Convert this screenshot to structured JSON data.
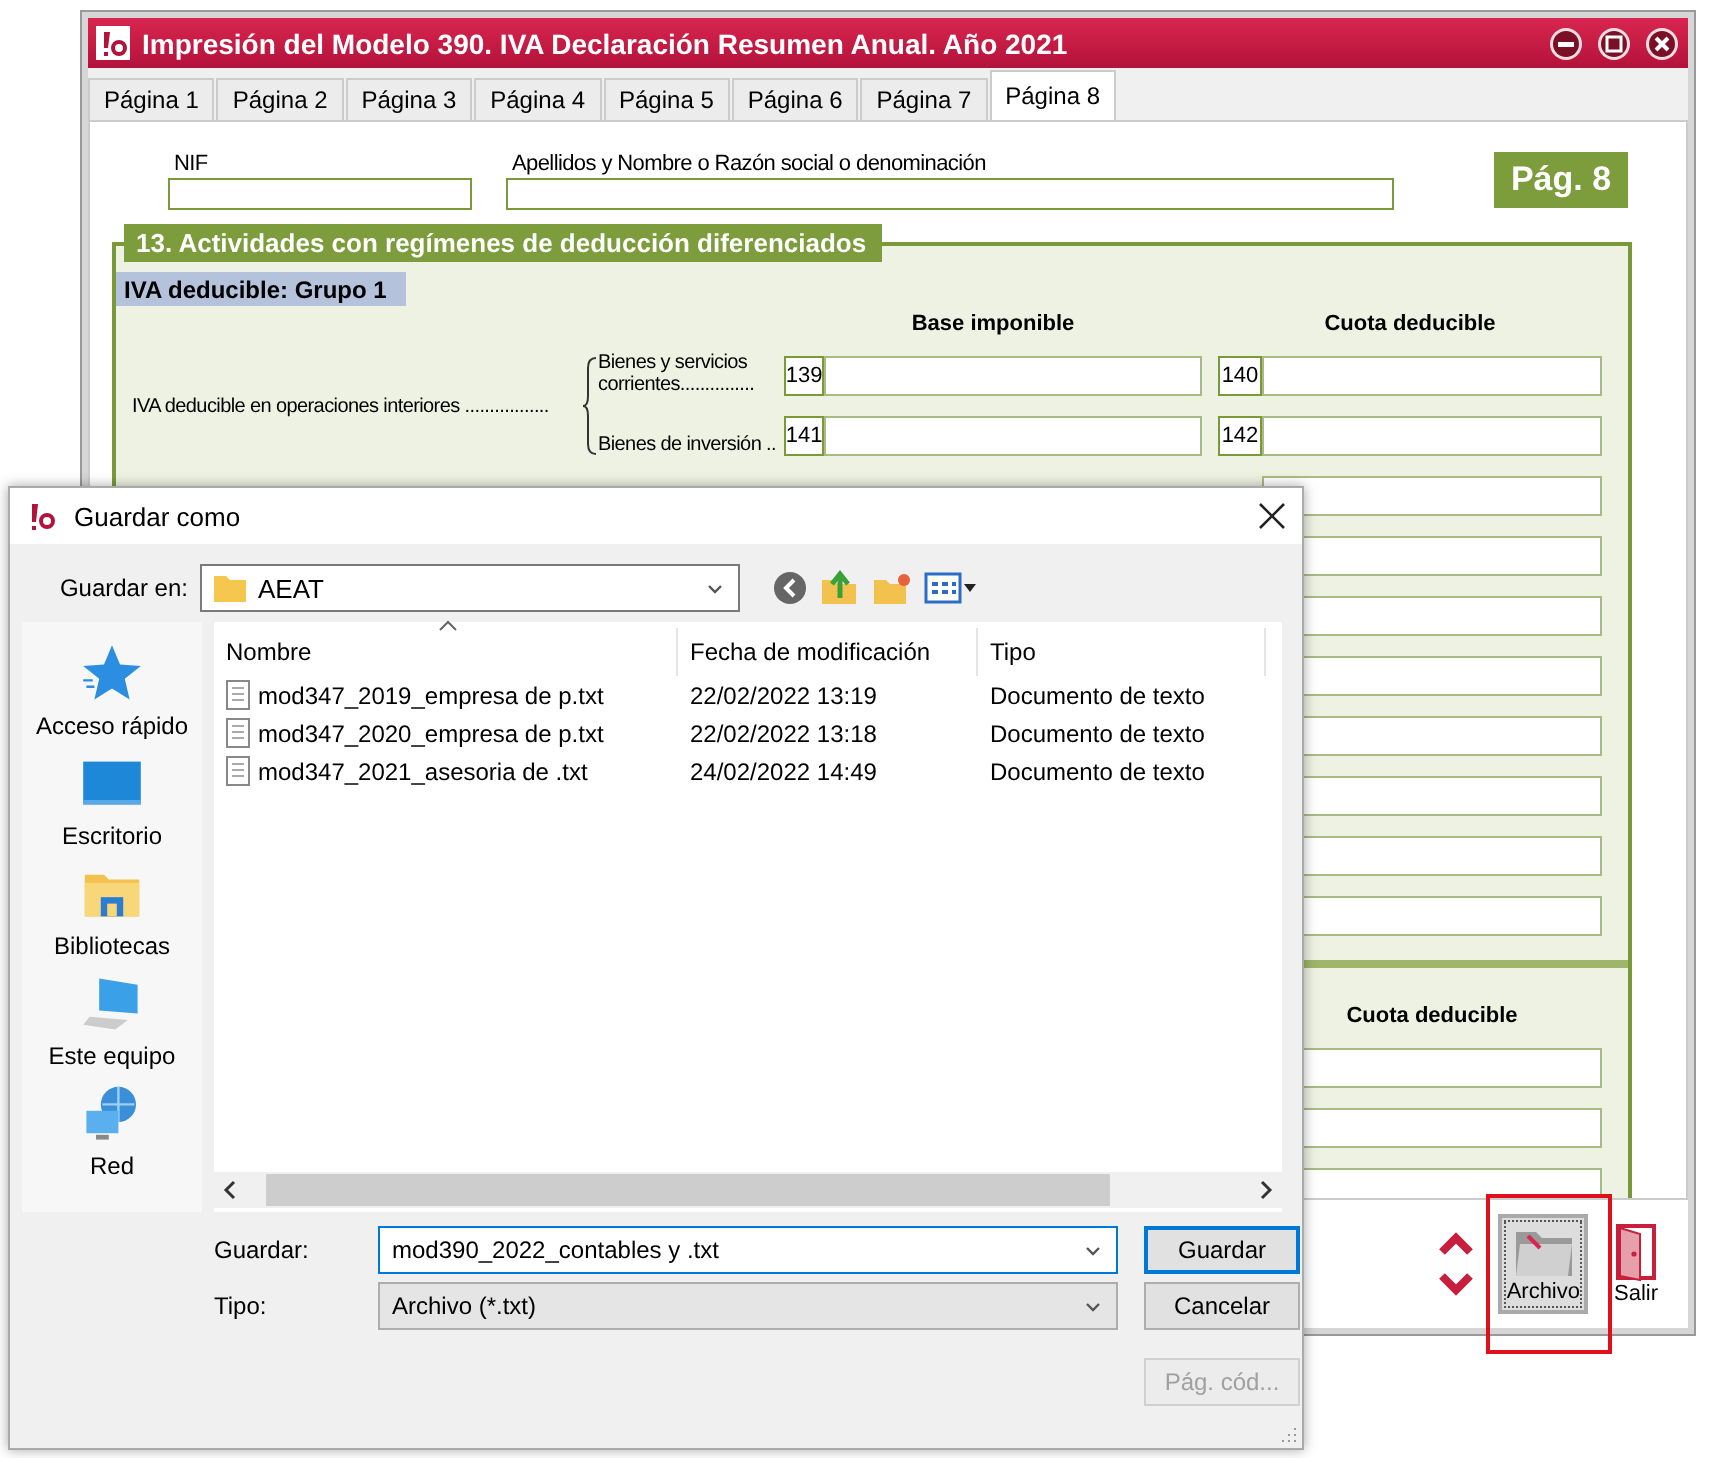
{
  "main_window": {
    "title": "Impresión del Modelo 390. IVA Declaración Resumen Anual. Año 2021",
    "tabs": [
      {
        "label": "Página 1",
        "selected": false
      },
      {
        "label": "Página 2",
        "selected": false
      },
      {
        "label": "Página 3",
        "selected": false
      },
      {
        "label": "Página 4",
        "selected": false
      },
      {
        "label": "Página 5",
        "selected": false
      },
      {
        "label": "Página 6",
        "selected": false
      },
      {
        "label": "Página 7",
        "selected": false
      },
      {
        "label": "Página 8",
        "selected": true
      }
    ],
    "header": {
      "nif_label": "NIF",
      "name_label": "Apellidos y Nombre o Razón social o denominación",
      "page_badge": "Pág. 8"
    },
    "section": {
      "title": "13. Actividades con regímenes de deducción diferenciados",
      "group": "IVA deducible: Grupo 1",
      "columns": [
        "Base imponible",
        "Cuota deducible"
      ],
      "rows_label": "IVA deducible en operaciones interiores .................",
      "rows": [
        {
          "label": "Bienes y servicios corrientes...............",
          "base_box": "139",
          "cuota_box": "140"
        },
        {
          "label": "Bienes de inversión ..",
          "base_box": "141",
          "cuota_box": "142"
        }
      ],
      "lower_column": "Cuota deducible"
    },
    "toolbar": [
      {
        "label": "Archivo",
        "kind": "folder",
        "selected": true
      },
      {
        "label": "Salir",
        "kind": "door",
        "selected": false
      }
    ]
  },
  "dialog": {
    "title": "Guardar como",
    "save_in_label": "Guardar en:",
    "save_in_value": "AEAT",
    "places": [
      {
        "label": "Acceso rápido",
        "kind": "star"
      },
      {
        "label": "Escritorio",
        "kind": "desktop"
      },
      {
        "label": "Bibliotecas",
        "kind": "library"
      },
      {
        "label": "Este equipo",
        "kind": "computer"
      },
      {
        "label": "Red",
        "kind": "network"
      }
    ],
    "columns": [
      "Nombre",
      "Fecha de modificación",
      "Tipo"
    ],
    "files": [
      {
        "name": "mod347_2019_empresa de p.txt",
        "date": "22/02/2022 13:19",
        "type": "Documento de texto"
      },
      {
        "name": "mod347_2020_empresa de p.txt",
        "date": "22/02/2022 13:18",
        "type": "Documento de texto"
      },
      {
        "name": "mod347_2021_asesoria de .txt",
        "date": "24/02/2022 14:49",
        "type": "Documento de texto"
      }
    ],
    "filename_label": "Guardar:",
    "filename_value": "mod390_2022_contables y .txt",
    "type_label": "Tipo:",
    "type_value": "Archivo (*.txt)",
    "buttons": [
      {
        "label": "Guardar",
        "default": true,
        "disabled": false
      },
      {
        "label": "Cancelar",
        "default": false,
        "disabled": false
      },
      {
        "label": "Pág. cód...",
        "default": false,
        "disabled": true
      }
    ]
  }
}
